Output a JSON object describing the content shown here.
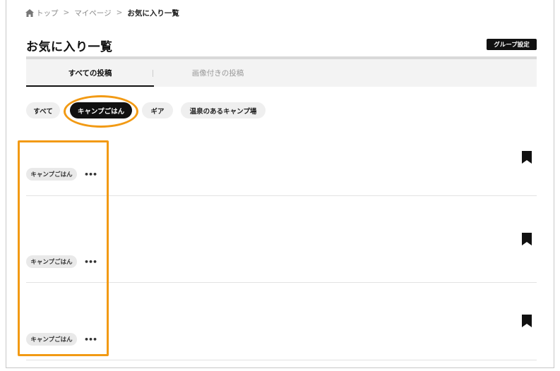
{
  "breadcrumb": {
    "home_icon": "home-icon",
    "items": [
      "トップ",
      "マイページ",
      "お気に入り一覧"
    ],
    "separator": ">"
  },
  "page": {
    "title": "お気に入り一覧",
    "group_settings_label": "グループ設定"
  },
  "tabs": [
    {
      "label": "すべての投稿",
      "active": true
    },
    {
      "label": "画像付きの投稿",
      "active": false
    }
  ],
  "filters": [
    {
      "label": "すべて",
      "selected": false
    },
    {
      "label": "キャンプごはん",
      "selected": true
    },
    {
      "label": "ギア",
      "selected": false
    },
    {
      "label": "温泉のあるキャンプ場",
      "selected": false
    }
  ],
  "posts": [
    {
      "tag": "キャンプごはん",
      "more_label": "•••",
      "bookmarked": true
    },
    {
      "tag": "キャンプごはん",
      "more_label": "•••",
      "bookmarked": true
    },
    {
      "tag": "キャンプごはん",
      "more_label": "•••",
      "bookmarked": true
    }
  ],
  "colors": {
    "accent_highlight": "#f29a14",
    "active_chip": "#111111",
    "chip_bg": "#efefef"
  }
}
